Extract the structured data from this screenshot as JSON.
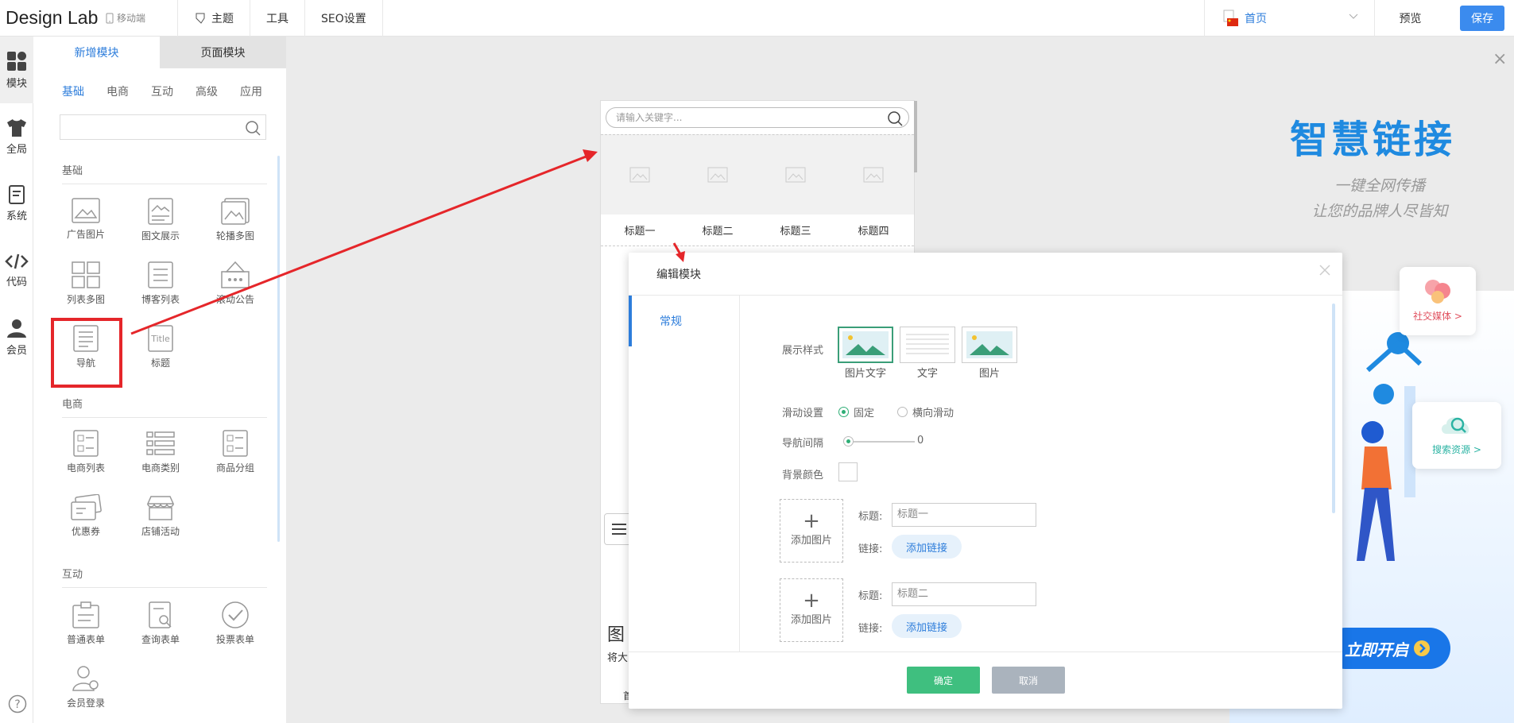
{
  "topbar": {
    "logo": "Design Lab",
    "mobile": "移动端",
    "nav": [
      "主题",
      "工具",
      "SEO设置"
    ],
    "page_select": "首页",
    "preview": "预览",
    "save": "保存"
  },
  "leftbar": {
    "items": [
      {
        "label": "模块",
        "icon": "modules-icon"
      },
      {
        "label": "全局",
        "icon": "shirt-icon"
      },
      {
        "label": "系统",
        "icon": "document-icon"
      },
      {
        "label": "代码",
        "icon": "code-icon"
      },
      {
        "label": "会员",
        "icon": "user-icon"
      }
    ],
    "help_icon": "help-icon"
  },
  "panel": {
    "tabs": [
      "新增模块",
      "页面模块"
    ],
    "subtabs": [
      "基础",
      "电商",
      "互动",
      "高级",
      "应用"
    ],
    "sections": [
      "基础",
      "电商",
      "互动"
    ],
    "basic_modules": [
      "广告图片",
      "图文展示",
      "轮播多图",
      "列表多图",
      "博客列表",
      "滚动公告",
      "导航",
      "标题"
    ],
    "ecom_modules": [
      "电商列表",
      "电商类别",
      "商品分组",
      "优惠券",
      "店铺活动"
    ],
    "interact_modules": [
      "普通表单",
      "查询表单",
      "投票表单",
      "会员登录"
    ]
  },
  "canvas": {
    "search_placeholder": "请输入关键字...",
    "nav_items": [
      "标题一",
      "标题二",
      "标题三",
      "标题四"
    ],
    "peek_texts": [
      "图",
      "将大",
      "首"
    ]
  },
  "dialog": {
    "title": "编辑模块",
    "side_tab": "常规",
    "labels": {
      "display_style": "展示样式",
      "scroll_setting": "滑动设置",
      "nav_spacing": "导航间隔",
      "bg_color": "背景颜色",
      "title": "标题:",
      "link": "链接:"
    },
    "style_options": [
      "图片文字",
      "文字",
      "图片"
    ],
    "scroll_options": [
      "固定",
      "横向滑动"
    ],
    "spacing_value": "0",
    "items": [
      {
        "add_image": "添加图片",
        "title_value": "标题一",
        "link_button": "添加链接"
      },
      {
        "add_image": "添加图片",
        "title_value": "标题二",
        "link_button": "添加链接"
      }
    ],
    "plus": "+",
    "ok": "确定",
    "cancel": "取消"
  },
  "ad": {
    "title": "智慧链接",
    "sub1": "一键全网传播",
    "sub2": "让您的品牌人尽皆知",
    "card1": "社交媒体 >",
    "card2": "搜索资源 >",
    "cta": "立即开启",
    "close": "×"
  },
  "colors": {
    "accent": "#2d7ddb",
    "ok": "#3fbf7f",
    "highlight": "#e5262a"
  }
}
